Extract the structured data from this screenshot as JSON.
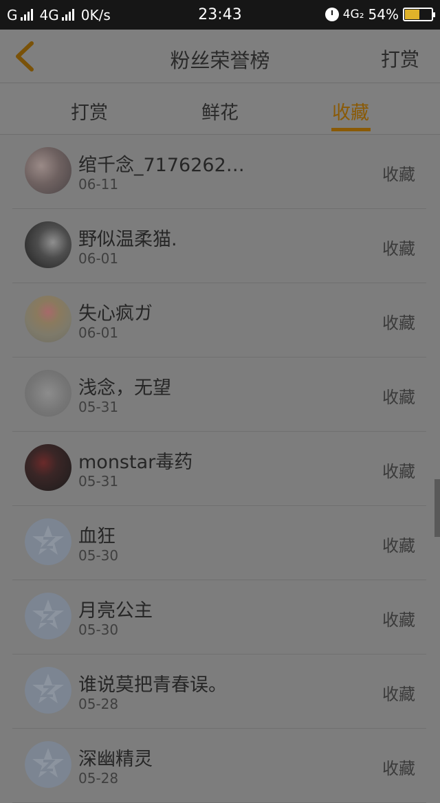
{
  "statusbar": {
    "carrier1": "G",
    "carrier2": "4G",
    "speed": "0K/s",
    "time": "23:43",
    "network": "4G₂",
    "battery": "54%",
    "battery_level": 0.54
  },
  "nav": {
    "title": "粉丝荣誉榜",
    "action": "打赏"
  },
  "tabs": [
    {
      "label": "打赏",
      "active": false
    },
    {
      "label": "鲜花",
      "active": false
    },
    {
      "label": "收藏",
      "active": true
    }
  ],
  "accent_color": "#8a5a06",
  "rows": [
    {
      "name": "绾千念_7176262…",
      "date": "06-11",
      "action": "收藏",
      "avatar": "photo-avatar"
    },
    {
      "name": "野似温柔猫.",
      "date": "06-01",
      "action": "收藏",
      "avatar": "photo-avatar"
    },
    {
      "name": "失心疯ガ",
      "date": "06-01",
      "action": "收藏",
      "avatar": "cake-avatar"
    },
    {
      "name": "浅念，无望",
      "date": "05-31",
      "action": "收藏",
      "avatar": "photo-avatar"
    },
    {
      "name": "monstar毒药",
      "date": "05-31",
      "action": "收藏",
      "avatar": "photo-avatar"
    },
    {
      "name": "血狂",
      "date": "05-30",
      "action": "收藏",
      "avatar": "default-avatar"
    },
    {
      "name": "月亮公主",
      "date": "05-30",
      "action": "收藏",
      "avatar": "default-avatar"
    },
    {
      "name": "谁说莫把青春误。",
      "date": "05-28",
      "action": "收藏",
      "avatar": "default-avatar"
    },
    {
      "name": "深幽精灵",
      "date": "05-28",
      "action": "收藏",
      "avatar": "default-avatar"
    }
  ]
}
